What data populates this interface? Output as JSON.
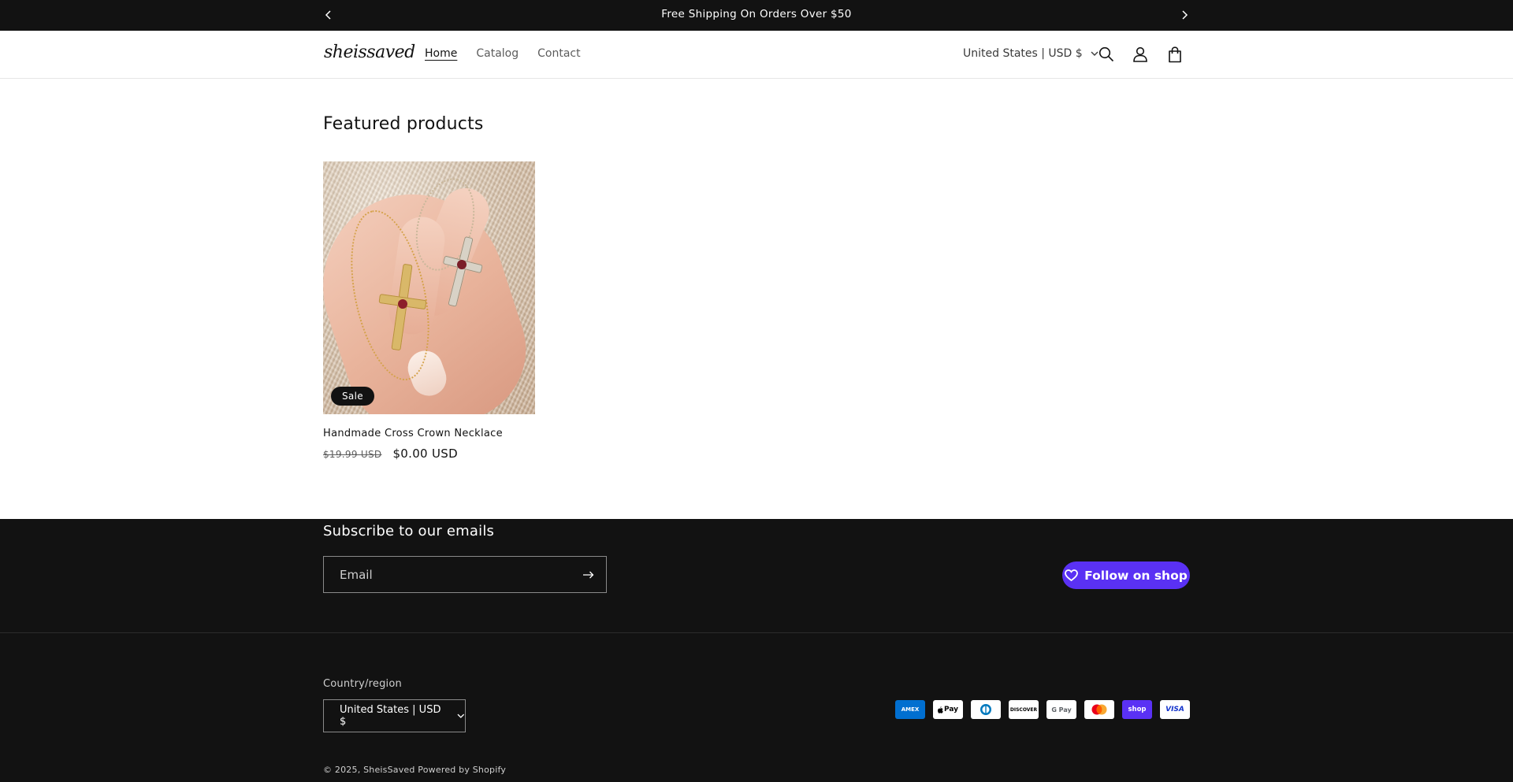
{
  "announcement": {
    "text": "Free Shipping On Orders Over $50",
    "prev_icon": "chevron-left-icon",
    "next_icon": "chevron-right-icon"
  },
  "header": {
    "logo": "sheissaved",
    "nav": [
      {
        "label": "Home",
        "active": true
      },
      {
        "label": "Catalog",
        "active": false
      },
      {
        "label": "Contact",
        "active": false
      }
    ],
    "localization": "United States | USD $",
    "icons": [
      "search-icon",
      "account-icon",
      "cart-icon"
    ]
  },
  "featured": {
    "title": "Featured products",
    "products": [
      {
        "title": "Handmade Cross Crown Necklace",
        "badge": "Sale",
        "price_regular": "$19.99 USD",
        "price_sale": "$0.00 USD"
      }
    ]
  },
  "footer": {
    "newsletter_title": "Subscribe to our emails",
    "email_placeholder": "Email",
    "follow_label": "Follow on shop",
    "country_label": "Country/region",
    "country_value": "United States | USD $",
    "payments": [
      {
        "name": "American Express",
        "label": "AMEX",
        "bg": "#016fd0",
        "fg": "#ffffff"
      },
      {
        "name": "Apple Pay",
        "label": "Pay",
        "bg": "#ffffff",
        "fg": "#000000"
      },
      {
        "name": "Diners Club",
        "label": "D",
        "bg": "#ffffff",
        "fg": "#0079be"
      },
      {
        "name": "Discover",
        "label": "DISCOVER",
        "bg": "#ffffff",
        "fg": "#000000"
      },
      {
        "name": "Google Pay",
        "label": "G Pay",
        "bg": "#ffffff",
        "fg": "#5f6368"
      },
      {
        "name": "Mastercard",
        "label": "",
        "bg": "#ffffff",
        "fg": "#000000"
      },
      {
        "name": "Shop Pay",
        "label": "shop",
        "bg": "#5a31f4",
        "fg": "#ffffff"
      },
      {
        "name": "Visa",
        "label": "VISA",
        "bg": "#ffffff",
        "fg": "#1434cb"
      }
    ],
    "copyright_prefix": "© 2025,",
    "copyright_store": "SheisSaved",
    "powered_by": "Powered by Shopify"
  },
  "colors": {
    "dark": "#121212",
    "shop_purple": "#5a31f4"
  }
}
